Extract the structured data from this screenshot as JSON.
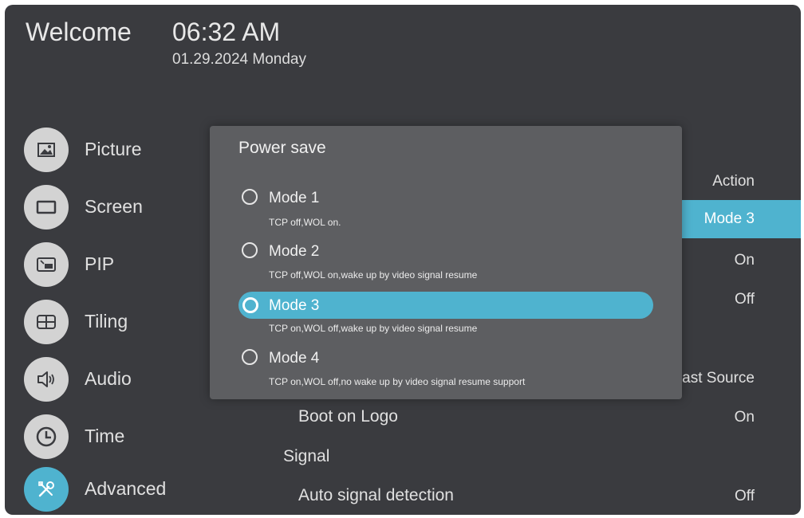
{
  "header": {
    "welcome": "Welcome",
    "time": "06:32 AM",
    "date": "01.29.2024 Monday"
  },
  "sidebar": {
    "items": [
      {
        "label": "Picture",
        "icon": "picture-icon"
      },
      {
        "label": "Screen",
        "icon": "screen-icon"
      },
      {
        "label": "PIP",
        "icon": "pip-icon"
      },
      {
        "label": "Tiling",
        "icon": "tiling-icon"
      },
      {
        "label": "Audio",
        "icon": "audio-icon"
      },
      {
        "label": "Time",
        "icon": "clock-icon"
      },
      {
        "label": "Advanced",
        "icon": "tools-icon",
        "active": true
      }
    ]
  },
  "settings": {
    "right_values": [
      "Action",
      "Mode 3",
      "On",
      "Off",
      "ast Source",
      "On",
      "Off"
    ],
    "boot_on_logo": "Boot on Logo",
    "signal_section": "Signal",
    "auto_signal_detection": "Auto signal detection"
  },
  "dialog": {
    "title": "Power save",
    "options": [
      {
        "label": "Mode 1",
        "desc": "TCP off,WOL on."
      },
      {
        "label": "Mode 2",
        "desc": "TCP off,WOL on,wake up by video signal resume"
      },
      {
        "label": "Mode 3",
        "desc": "TCP on,WOL off,wake up by video signal resume",
        "selected": true
      },
      {
        "label": "Mode 4",
        "desc": "TCP on,WOL off,no wake up by video signal resume support"
      }
    ]
  },
  "colors": {
    "background": "#3a3b3f",
    "dialog": "#5d5e61",
    "accent": "#4fb3cf",
    "icon_circle": "#d3d3d3"
  }
}
